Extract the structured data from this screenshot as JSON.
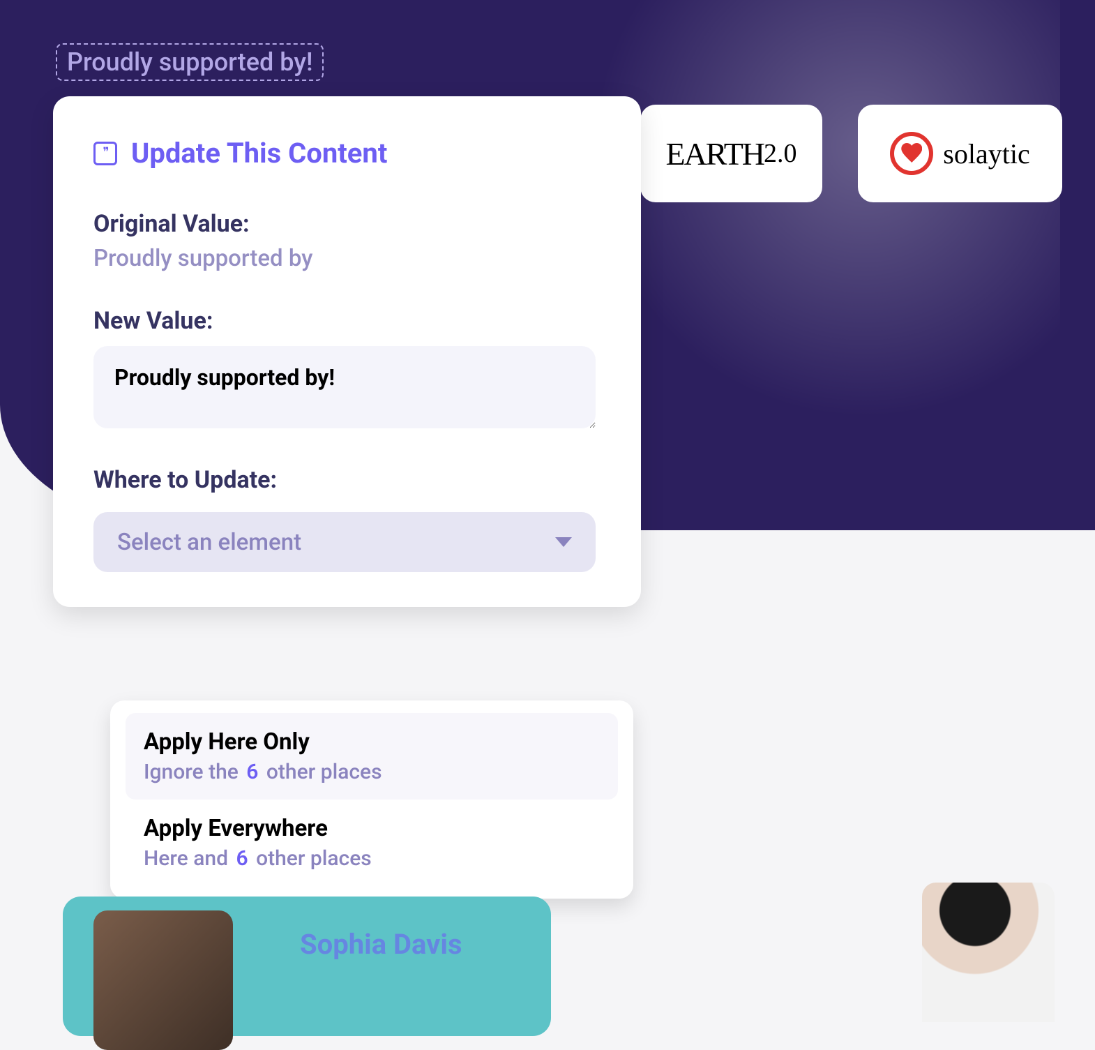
{
  "highlighted_text": "Proudly supported by!",
  "sponsors": {
    "earth": {
      "name": "EARTH",
      "version": "2.0"
    },
    "solaytic": {
      "name": "solaytic"
    }
  },
  "popup": {
    "title": "Update This Content",
    "original_label": "Original Value:",
    "original_value": "Proudly supported by",
    "new_label": "New Value:",
    "new_value": "Proudly supported by!",
    "where_label": "Where to Update:",
    "select_placeholder": "Select an element"
  },
  "dropdown": {
    "opt1": {
      "title": "Apply Here Only",
      "sub_pre": "Ignore the",
      "count": "6",
      "sub_post": "other places"
    },
    "opt2": {
      "title": "Apply Everywhere",
      "sub_pre": "Here and",
      "count": "6",
      "sub_post": "other places"
    }
  },
  "profile_name": "Sophia Davis"
}
